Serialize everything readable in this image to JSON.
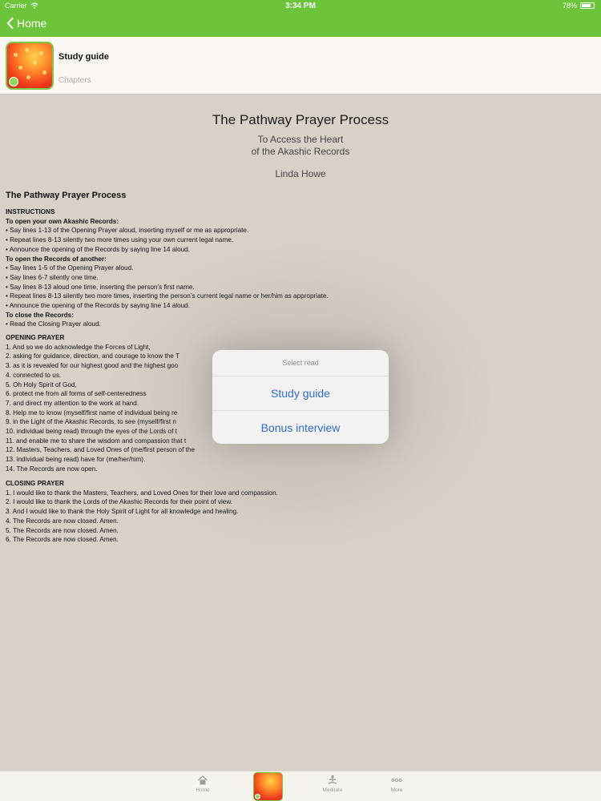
{
  "status_bar": {
    "carrier": "Carrier",
    "time": "3:34 PM",
    "battery": "78%"
  },
  "nav": {
    "back_label": "Home"
  },
  "header": {
    "title": "Study guide",
    "subtitle": "Chapters"
  },
  "document": {
    "title": "The Pathway Prayer Process",
    "subtitle_line1": "To Access the Heart",
    "subtitle_line2": "of the Akashic Records",
    "author": "Linda Howe",
    "section_heading": "The Pathway Prayer Process",
    "instructions": {
      "heading": "INSTRUCTIONS",
      "own_heading": "To open your own Akashic Records:",
      "own_lines": [
        "• Say lines 1-13 of the Opening Prayer aloud, inserting myself or me as appropriate.",
        "• Repeat lines 8-13 silently two more times using your own current legal name.",
        "• Announce the opening of the Records by saying line 14 aloud."
      ],
      "another_heading": "To open the Records of another:",
      "another_lines": [
        "• Say lines 1-5 of the Opening Prayer aloud.",
        "• Say lines 6-7 silently one time.",
        "• Say lines 8-13 aloud one time, inserting the person’s first name.",
        "• Repeat lines 8-13 silently two more times, inserting the person’s current legal name or her/him as appropriate.",
        "• Announce the opening of the Records by saying line 14 aloud."
      ],
      "close_heading": "To close the Records:",
      "close_lines": [
        "• Read the Closing Prayer aloud."
      ]
    },
    "opening_prayer": {
      "heading": "OPENING PRAYER",
      "lines": [
        "1. And so we do acknowledge the Forces of Light,",
        "2. asking for guidance, direction, and courage to know the T",
        "3. as it is revealed for our highest good and the highest goo",
        "4. connected to us.",
        "5. Oh Holy Spirit of God,",
        "6. protect me from all forms of self-centeredness",
        "7. and direct my attention to the work at hand.",
        "8. Help me to know (myself/first name of individual being re",
        "9. in the Light of the Akashic Records, to see (myself/first n",
        "10. individual being read) through the eyes of the Lords of t",
        "11. and enable me to share the wisdom and compassion that t",
        "12. Masters, Teachers, and Loved Ones of (me/first person of the",
        "13. individual being read) have for (me/her/him).",
        "14. The Records are now open."
      ]
    },
    "closing_prayer": {
      "heading": "CLOSING PRAYER",
      "lines": [
        "1. I would like to thank the Masters, Teachers, and Loved Ones for their love and compassion.",
        "2. I would like to thank the Lords of the Akashic Records for their point of view.",
        "3. And I would like to thank the Holy Spirit of Light for all knowledge and healing.",
        "4. The Records are now closed. Amen.",
        "5. The Records are now closed. Amen.",
        "6. The Records are now closed. Amen."
      ]
    }
  },
  "popover": {
    "title": "Select read",
    "options": [
      "Study guide",
      "Bonus interview"
    ]
  },
  "tabbar": {
    "items": [
      {
        "label": "Home",
        "icon": "home-icon"
      },
      {
        "label": "",
        "icon": "app-logo-icon"
      },
      {
        "label": "Meditate",
        "icon": "meditate-icon"
      },
      {
        "label": "More",
        "icon": "more-icon"
      }
    ]
  },
  "colors": {
    "nav_green": "#6cc43a",
    "background": "#d8d1c8",
    "link_blue": "#2f6fd1"
  }
}
